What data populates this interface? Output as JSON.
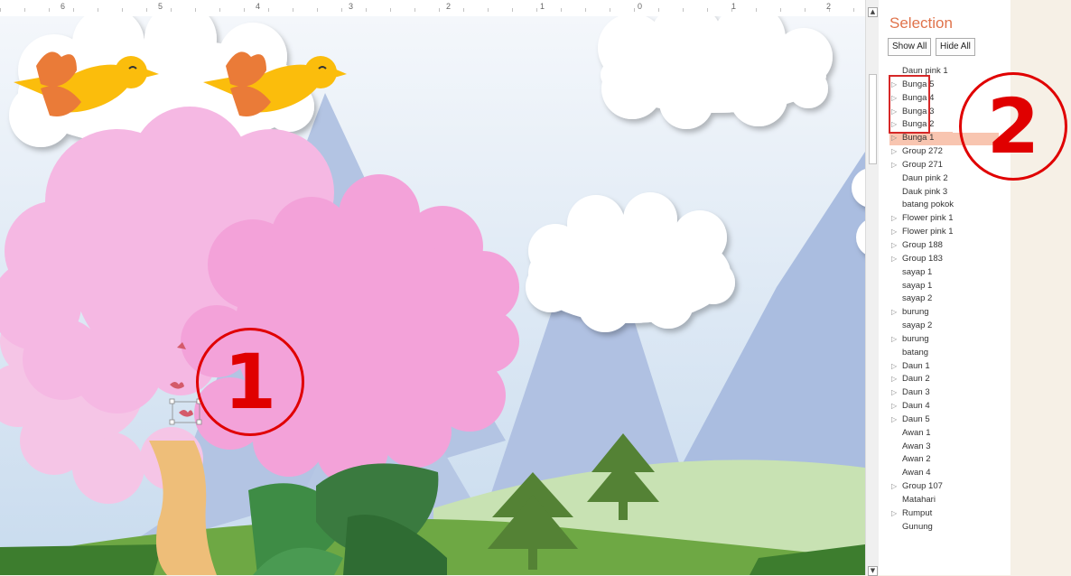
{
  "ruler": {
    "labels": [
      "6",
      "5",
      "4",
      "3",
      "2",
      "1",
      "0",
      "1",
      "2"
    ]
  },
  "selection_pane": {
    "title": "Selection",
    "show_all": "Show All",
    "hide_all": "Hide All",
    "items": [
      {
        "label": "Daun pink 1",
        "expandable": false,
        "selected": false
      },
      {
        "label": "Bunga 5",
        "expandable": true,
        "selected": false
      },
      {
        "label": "Bunga 4",
        "expandable": true,
        "selected": false
      },
      {
        "label": "Bunga 3",
        "expandable": true,
        "selected": false
      },
      {
        "label": "Bunga 2",
        "expandable": true,
        "selected": false
      },
      {
        "label": "Bunga 1",
        "expandable": true,
        "selected": true
      },
      {
        "label": "Group 272",
        "expandable": true,
        "selected": false
      },
      {
        "label": "Group 271",
        "expandable": true,
        "selected": false
      },
      {
        "label": "Daun pink 2",
        "expandable": false,
        "selected": false
      },
      {
        "label": "Dauk pink 3",
        "expandable": false,
        "selected": false
      },
      {
        "label": "batang pokok",
        "expandable": false,
        "selected": false
      },
      {
        "label": "Flower pink 1",
        "expandable": true,
        "selected": false
      },
      {
        "label": "Flower pink 1",
        "expandable": true,
        "selected": false
      },
      {
        "label": "Group 188",
        "expandable": true,
        "selected": false
      },
      {
        "label": "Group 183",
        "expandable": true,
        "selected": false
      },
      {
        "label": "sayap 1",
        "expandable": false,
        "selected": false
      },
      {
        "label": "sayap 1",
        "expandable": false,
        "selected": false
      },
      {
        "label": "sayap 2",
        "expandable": false,
        "selected": false
      },
      {
        "label": "burung",
        "expandable": true,
        "selected": false
      },
      {
        "label": "sayap 2",
        "expandable": false,
        "selected": false
      },
      {
        "label": "burung",
        "expandable": true,
        "selected": false
      },
      {
        "label": "batang",
        "expandable": false,
        "selected": false
      },
      {
        "label": "Daun 1",
        "expandable": true,
        "selected": false
      },
      {
        "label": "Daun 2",
        "expandable": true,
        "selected": false
      },
      {
        "label": "Daun 3",
        "expandable": true,
        "selected": false
      },
      {
        "label": "Daun 4",
        "expandable": true,
        "selected": false
      },
      {
        "label": "Daun 5",
        "expandable": true,
        "selected": false
      },
      {
        "label": "Awan 1",
        "expandable": false,
        "selected": false
      },
      {
        "label": "Awan 3",
        "expandable": false,
        "selected": false
      },
      {
        "label": "Awan 2",
        "expandable": false,
        "selected": false
      },
      {
        "label": "Awan 4",
        "expandable": false,
        "selected": false
      },
      {
        "label": "Group 107",
        "expandable": true,
        "selected": false
      },
      {
        "label": "Matahari",
        "expandable": false,
        "selected": false
      },
      {
        "label": "Rumput",
        "expandable": true,
        "selected": false
      },
      {
        "label": "Gunung",
        "expandable": false,
        "selected": false
      }
    ]
  },
  "annotations": {
    "one": "1",
    "two": "2"
  },
  "colors": {
    "accent": "#e0734b",
    "selected_bg": "#f8c5b0",
    "annotation_red": "#e00000",
    "sky_top": "#f4f7fb",
    "sky_bottom": "#cfe0f0",
    "mountain": "#b0c1e2",
    "grass": "#6ea844",
    "tree_pink": "#f3a2d9",
    "tree_light_pink": "#f5bde3",
    "trunk": "#eebe79",
    "bird_yellow": "#fbbd0c",
    "bird_wing": "#ea7b38"
  }
}
